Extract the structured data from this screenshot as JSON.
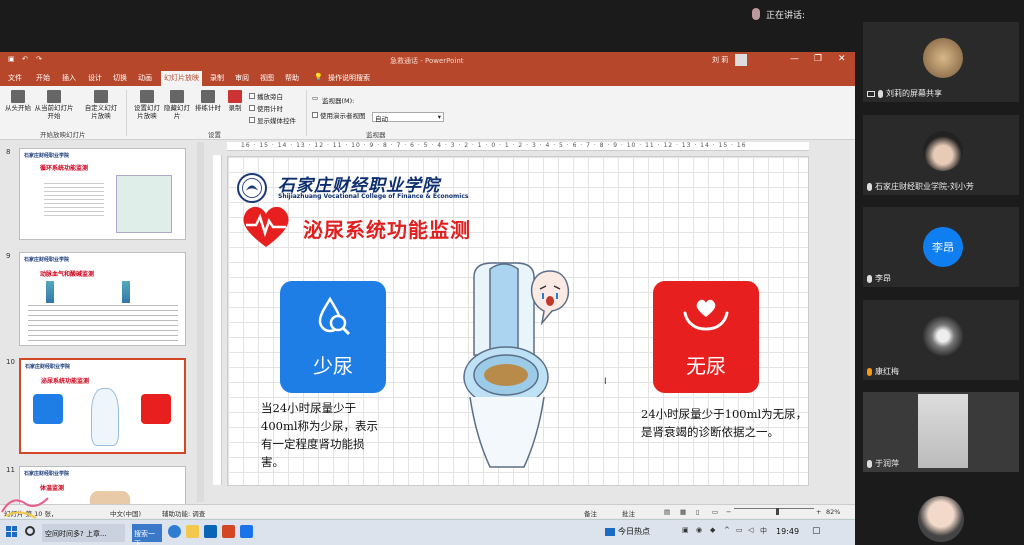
{
  "meeting": {
    "speaking_label": "正在讲话:"
  },
  "ppt": {
    "window_title": "急救通话 - PowerPoint",
    "user_name": "刘 莉",
    "window_controls": [
      "—",
      "❐",
      "✕"
    ],
    "tabs": [
      "文件",
      "开始",
      "插入",
      "设计",
      "切换",
      "动画",
      "幻灯片放映",
      "录制",
      "审阅",
      "视图",
      "帮助"
    ],
    "active_tab": "幻灯片放映",
    "tell_me": "操作说明搜索",
    "ribbon": {
      "btn_from_start": "从头开始",
      "btn_from_current": "从当前幻灯片开始",
      "btn_custom": "自定义幻灯片放映",
      "grp_start": "开始放映幻灯片",
      "btn_setup": "设置幻灯片放映",
      "btn_hide": "隐藏幻灯片",
      "btn_rehearse": "排练计时",
      "btn_record": "录制",
      "chk_narration": "播放旁白",
      "chk_timings": "使用计时",
      "chk_media": "显示媒体控件",
      "grp_setup": "设置",
      "monitor_label": "监视器(M):",
      "monitor_value": "自动",
      "chk_presenter": "使用演示者视图",
      "grp_monitor": "监视器"
    },
    "thumbnails": [
      {
        "num": "8",
        "title": "循环系统功能监测",
        "header": "石家庄财经职业学院"
      },
      {
        "num": "9",
        "title": "动脉血气和酸碱监测",
        "header": "石家庄财经职业学院"
      },
      {
        "num": "10",
        "title": "泌尿系统功能监测",
        "header": "石家庄财经职业学院",
        "selected": true
      },
      {
        "num": "11",
        "title": "体温监测",
        "header": "石家庄财经职业学院"
      }
    ],
    "ruler_marks": "16 · 15 · 14 · 13 · 12 · 11 · 10 · 9 · 8 · 7 · 6 · 5 · 4 · 3 · 2 · 1 · 0 · 1 · 2 · 3 · 4 · 5 · 6 · 7 · 8 · 9 · 10 · 11 · 12 · 13 · 14 · 15 · 16",
    "slide": {
      "school_cn": "石家庄财经职业学院",
      "school_en": "Shijiazhuang Vocational College of Finance & Economics",
      "title": "泌尿系统功能监测",
      "card_oliguria": "少尿",
      "card_anuria": "无尿",
      "desc_oliguria": "当24小时尿量少于400ml称为少尿，表示有一定程度肾功能损害。",
      "desc_anuria": "24小时尿量少于100ml为无尿，是肾衰竭的诊断依据之一。"
    },
    "status": {
      "slide_info": "幻灯片 第 10 张，",
      "language": "中文(中国)",
      "accessibility": "辅助功能: 调查",
      "notes": "备注",
      "comments": "批注",
      "zoom": "82%"
    }
  },
  "participants": [
    {
      "name": "刘莉的屏幕共享",
      "type": "photo"
    },
    {
      "name": "石家庄财经职业学院-刘小芳",
      "type": "photo"
    },
    {
      "name": "李昂",
      "type": "avatar",
      "avatar_text": "李昂"
    },
    {
      "name": "康红梅",
      "type": "photo"
    },
    {
      "name": "于润萍",
      "type": "photo"
    }
  ],
  "taskbar": {
    "app1": "空间时间多? 上章...",
    "search_btn": "搜索一下",
    "news": "今日热点",
    "time": "19:49"
  },
  "colors": {
    "ppt_accent": "#b7472a",
    "card_blue": "#1f7ee6",
    "card_red": "#e81f1f",
    "title_red": "#e02020",
    "school_navy": "#0e2f6e"
  }
}
